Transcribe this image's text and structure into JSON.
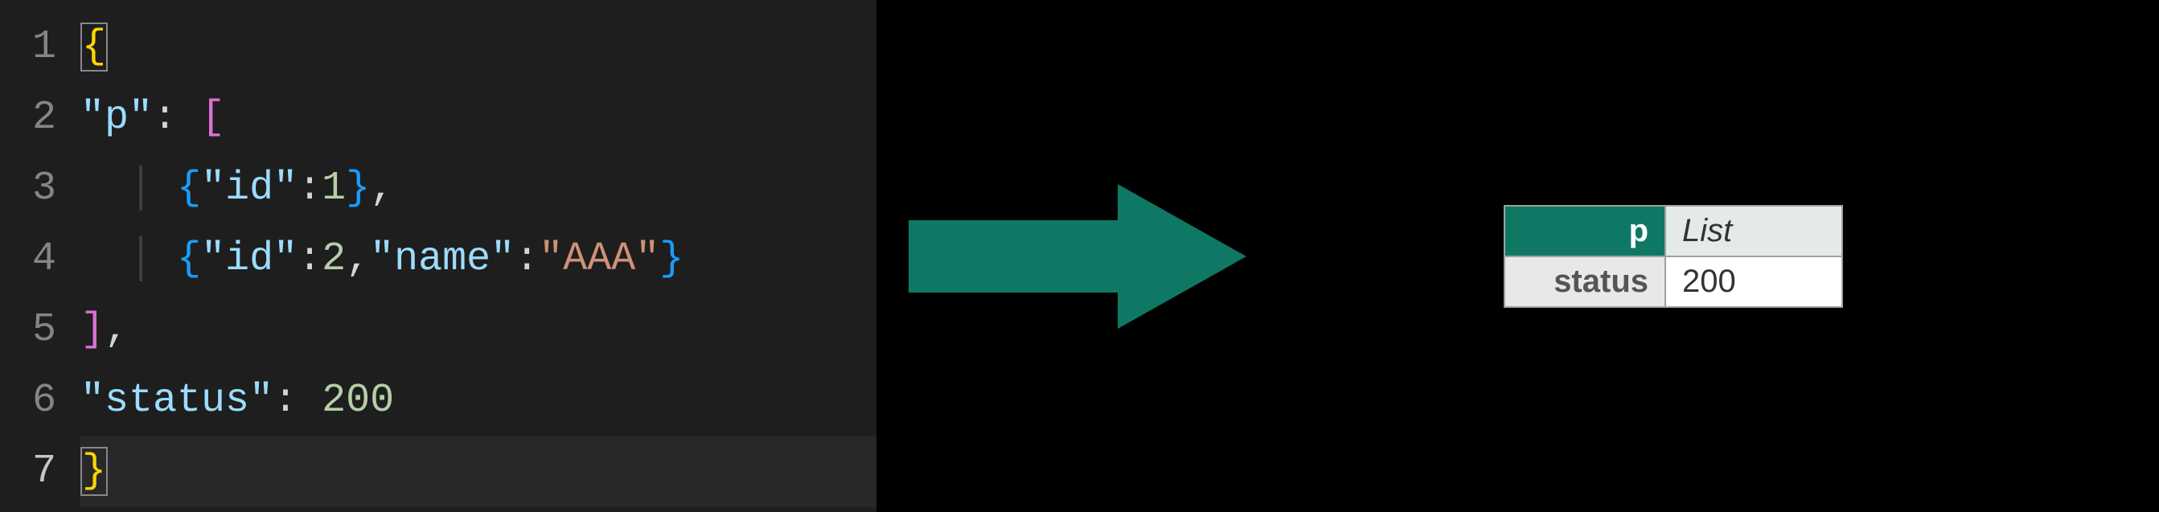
{
  "editor": {
    "line_numbers": [
      "1",
      "2",
      "3",
      "4",
      "5",
      "6",
      "7"
    ],
    "current_line": 7,
    "tokens": {
      "l1_brace_open": "{",
      "l2_key_p": "\"p\"",
      "l2_bracket_open": "[",
      "l3_brace_open": "{",
      "l3_key_id": "\"id\"",
      "l3_val_1": "1",
      "l3_brace_close": "}",
      "l4_brace_open": "{",
      "l4_key_id": "\"id\"",
      "l4_val_2": "2",
      "l4_key_name": "\"name\"",
      "l4_val_aaa": "\"AAA\"",
      "l4_brace_close": "}",
      "l5_bracket_close": "]",
      "l6_key_status": "\"status\"",
      "l6_val_200": "200",
      "l7_brace_close": "}",
      "colon": ":",
      "comma": ",",
      "space": " ",
      "guide": "│"
    }
  },
  "arrow": {
    "color": "#0f7864"
  },
  "table": {
    "rows": [
      {
        "key": "p",
        "value": "List",
        "selected": true,
        "italic": true
      },
      {
        "key": "status",
        "value": "200",
        "selected": false,
        "italic": false
      }
    ]
  }
}
